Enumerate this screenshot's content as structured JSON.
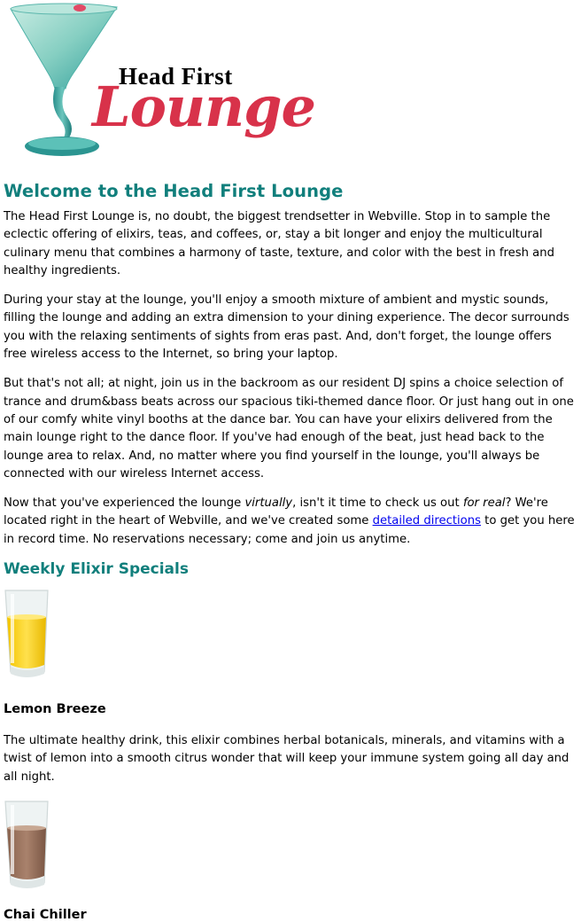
{
  "logo": {
    "line1": "Head First",
    "line2": "Lounge",
    "colors": {
      "script": "#d8324a",
      "small": "#000000",
      "glass": "#3aa6a2"
    }
  },
  "main": {
    "title": "Welcome to the Head First Lounge",
    "para1": "The Head First Lounge is, no doubt, the biggest trendsetter in Webville. Stop in to sample the eclectic offering of elixirs, teas, and coffees, or, stay a bit longer and enjoy the multicultural culinary menu that combines a harmony of taste, texture, and color with the best in fresh and healthy ingredients.",
    "para2": "During your stay at the lounge, you'll enjoy a smooth mixture of ambient and mystic sounds, filling the lounge and adding an extra dimension to your dining experience. The decor surrounds you with the relaxing sentiments of sights from eras past. And, don't forget, the lounge offers free wireless access to the Internet, so bring your laptop.",
    "para3": "But that's not all; at night, join us in the backroom as our resident DJ spins a choice selection of trance and drum&bass beats across our spacious tiki-themed dance floor. Or just hang out in one of our comfy white vinyl booths at the dance bar. You can have your elixirs delivered from the main lounge right to the dance floor. If you've had enough of the beat, just head back to the lounge area to relax. And, no matter where you find yourself in the lounge, you'll always be connected with our wireless Internet access.",
    "para4": {
      "t1": "Now that you've experienced the lounge ",
      "em1": "virtually",
      "t2": ", isn't it time to check us out ",
      "em2": "for real",
      "t3": "? We're located right in the heart of Webville, and we've created some ",
      "link": "detailed directions",
      "t4": " to get you here in record time. No reservations necessary; come and join us anytime."
    }
  },
  "specials": {
    "title": "Weekly Elixir Specials",
    "items": [
      {
        "name": "Lemon Breeze",
        "image_icon": "lemon-drink-glass-icon",
        "description": "The ultimate healthy drink, this elixir combines herbal botanicals, minerals, and vitamins with a twist of lemon into a smooth citrus wonder that will keep your immune system going all day and all night."
      },
      {
        "name": "Chai Chiller",
        "image_icon": "chai-drink-glass-icon"
      }
    ]
  }
}
